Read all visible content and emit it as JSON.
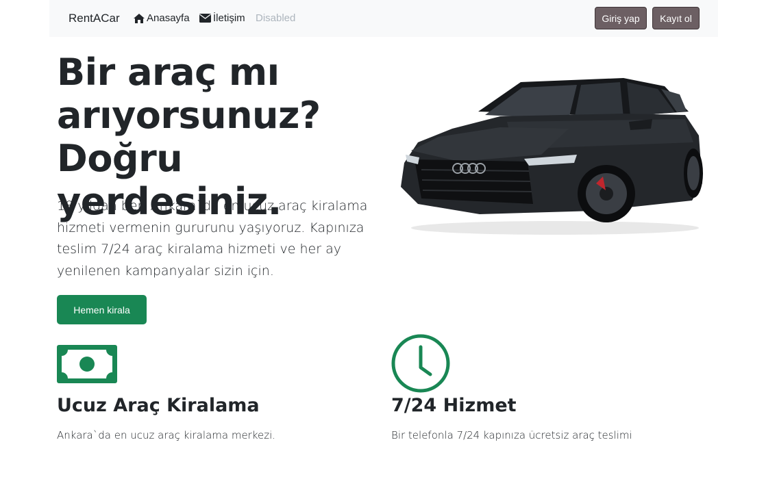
{
  "nav": {
    "brand": "RentACar",
    "links": [
      {
        "label": "Anasayfa",
        "icon": "home-icon"
      },
      {
        "label": "İletişim",
        "icon": "envelope-icon"
      },
      {
        "label": "Disabled",
        "icon": null
      }
    ],
    "login_label": "Giriş yap",
    "register_label": "Kayıt ol"
  },
  "hero": {
    "title": "Bir araç mı arıyorsunuz? Doğru yerdesiniz.",
    "lead": "18 yıldan beri Ankara`da en ucuz araç kiralama hizmeti vermenin gururunu yaşıyoruz. Kapınıza teslim 7/24 araç kiralama hizmeti ve her ay yenilenen kampanyalar sizin için.",
    "cta_label": "Hemen kirala",
    "image": "black-station-wagon-car"
  },
  "features": [
    {
      "icon": "cash-icon",
      "title": "Ucuz Araç Kiralama",
      "text": "Ankara`da en ucuz araç kiralama merkezi."
    },
    {
      "icon": "clock-icon",
      "title": "7/24 Hizmet",
      "text": "Bir telefonla 7/24 kapınıza ücretsiz araç teslimi"
    }
  ],
  "colors": {
    "primary_green": "#198754",
    "nav_button": "#6c5f63",
    "navbar_bg": "#f8f9fa",
    "disabled_link": "#adb5bd"
  }
}
